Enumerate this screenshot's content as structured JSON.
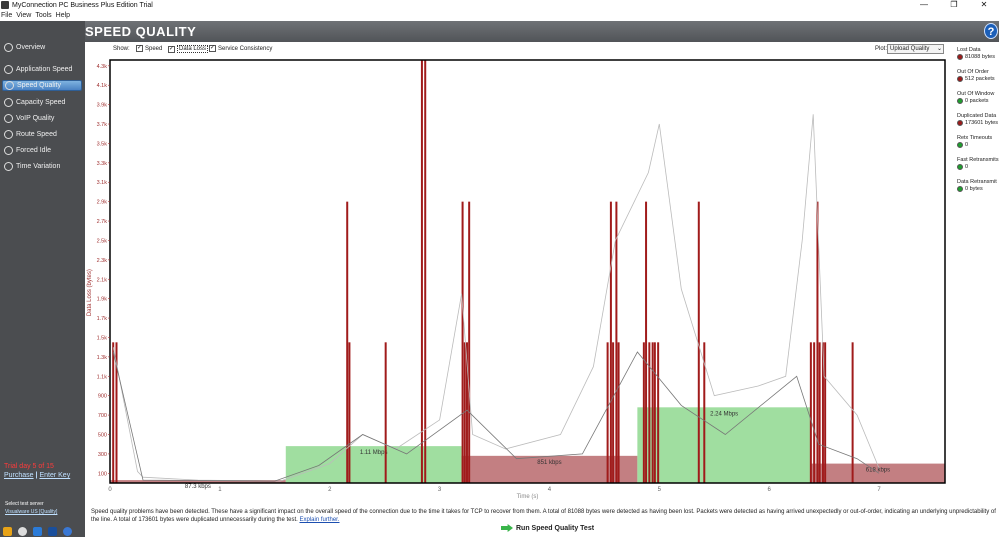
{
  "window": {
    "title": "MyConnection PC Business Plus Edition Trial",
    "controls": [
      "—",
      "❐",
      "✕"
    ]
  },
  "menu": [
    "File",
    "View",
    "Tools",
    "Help"
  ],
  "sidebar": {
    "items": [
      {
        "label": "Overview",
        "icon": "gear-icon"
      },
      {
        "label": "Application Speed",
        "icon": "app-icon"
      },
      {
        "label": "Speed Quality",
        "icon": "speed-icon"
      },
      {
        "label": "Capacity Speed",
        "icon": "capacity-icon"
      },
      {
        "label": "VoIP Quality",
        "icon": "phone-icon"
      },
      {
        "label": "Route Speed",
        "icon": "route-icon"
      },
      {
        "label": "Forced Idle",
        "icon": "idle-icon"
      },
      {
        "label": "Time Variation",
        "icon": "clock-icon"
      }
    ],
    "active_index": 2,
    "trial": "Trial day 5 of 15",
    "purchase": "Purchase",
    "separator": "|",
    "enter_key": "Enter Key",
    "select_server_label": "Select test server",
    "server": "Visualware US [Quality]"
  },
  "header": {
    "title": "SPEED QUALITY",
    "help": "?"
  },
  "controls": {
    "show_label": "Show:",
    "checkboxes": [
      {
        "label": "Speed",
        "checked": true
      },
      {
        "label": "Data Loss",
        "checked": true
      },
      {
        "label": "Service Consistency",
        "checked": true
      }
    ],
    "plot_label": "Plot:",
    "plot_value": "Upload Quality"
  },
  "stats": [
    {
      "label": "Lost Data",
      "value": "81088 bytes",
      "status": "#9b1b1b"
    },
    {
      "label": "Out Of Order",
      "value": "512 packets",
      "status": "#9b1b1b"
    },
    {
      "label": "Out Of Window",
      "value": "0 packets",
      "status": "#1e9e2e"
    },
    {
      "label": "Duplicated Data",
      "value": "173601 bytes",
      "status": "#9b1b1b"
    },
    {
      "label": "Retx Timeouts",
      "value": "0",
      "status": "#1e9e2e"
    },
    {
      "label": "Fast Retransmits",
      "value": "0",
      "status": "#1e9e2e"
    },
    {
      "label": "Data Retransmit",
      "value": "0 bytes",
      "status": "#1e9e2e"
    }
  ],
  "chart_data": {
    "type": "bar",
    "ylabel": "Data Loss (bytes)",
    "xlabel": "Time (s)",
    "yticks": [
      "100",
      "300",
      "500",
      "700",
      "900",
      "1.1k",
      "1.3k",
      "1.5k",
      "1.7k",
      "1.9k",
      "2.1k",
      "2.3k",
      "2.5k",
      "2.7k",
      "2.9k",
      "3.1k",
      "3.3k",
      "3.5k",
      "3.7k",
      "3.9k",
      "4.1k",
      "4.3k"
    ],
    "ytick_values": [
      100,
      300,
      500,
      700,
      900,
      1100,
      1300,
      1500,
      1700,
      1900,
      2100,
      2300,
      2500,
      2700,
      2900,
      3100,
      3300,
      3500,
      3700,
      3900,
      4100,
      4300
    ],
    "xticks": [
      "0",
      "1",
      "2",
      "3",
      "4",
      "5",
      "6",
      "7"
    ],
    "xtick_values": [
      0,
      1,
      2,
      3,
      4,
      5,
      6,
      7
    ],
    "xlim": [
      0,
      7.6
    ],
    "ylim": [
      0,
      4360
    ],
    "speed_segments": [
      {
        "x0": 0.0,
        "x1": 1.6,
        "value": 30,
        "label": "87.3 kbps",
        "color": "#b8686c"
      },
      {
        "x0": 1.6,
        "x1": 3.2,
        "value": 380,
        "label": "1.11 Mbps",
        "color": "#8fd88f"
      },
      {
        "x0": 3.2,
        "x1": 4.8,
        "value": 280,
        "label": "851 kbps",
        "color": "#b8686c"
      },
      {
        "x0": 4.8,
        "x1": 6.38,
        "value": 780,
        "label": "2.24 Mbps",
        "color": "#8fd88f"
      },
      {
        "x0": 6.38,
        "x1": 7.6,
        "value": 200,
        "label": "618 kbps",
        "color": "#b8686c"
      }
    ],
    "loss_bars": [
      [
        0.02,
        1450
      ],
      [
        0.05,
        1450
      ],
      [
        2.15,
        2900
      ],
      [
        2.17,
        1450
      ],
      [
        2.5,
        1450
      ],
      [
        2.83,
        4360
      ],
      [
        2.86,
        4360
      ],
      [
        3.2,
        2900
      ],
      [
        3.22,
        1450
      ],
      [
        3.24,
        1450
      ],
      [
        3.26,
        2900
      ],
      [
        4.52,
        1450
      ],
      [
        4.55,
        2900
      ],
      [
        4.57,
        1450
      ],
      [
        4.6,
        2900
      ],
      [
        4.62,
        1450
      ],
      [
        4.85,
        1450
      ],
      [
        4.87,
        2900
      ],
      [
        4.9,
        1450
      ],
      [
        4.93,
        1450
      ],
      [
        4.95,
        1450
      ],
      [
        4.98,
        1450
      ],
      [
        5.35,
        2900
      ],
      [
        5.4,
        1450
      ],
      [
        6.37,
        1450
      ],
      [
        6.4,
        1450
      ],
      [
        6.43,
        2900
      ],
      [
        6.45,
        1450
      ],
      [
        6.48,
        1450
      ],
      [
        6.5,
        1450
      ],
      [
        6.75,
        1450
      ]
    ],
    "consistency_line_gray": [
      [
        0.03,
        1400
      ],
      [
        0.25,
        120
      ],
      [
        0.3,
        60
      ],
      [
        0.8,
        30
      ],
      [
        1.55,
        20
      ],
      [
        2.0,
        200
      ],
      [
        2.3,
        500
      ],
      [
        2.6,
        350
      ],
      [
        3.0,
        650
      ],
      [
        3.2,
        1950
      ],
      [
        3.3,
        500
      ],
      [
        3.6,
        350
      ],
      [
        4.1,
        500
      ],
      [
        4.4,
        1200
      ],
      [
        4.6,
        2500
      ],
      [
        4.9,
        3200
      ],
      [
        5.0,
        3700
      ],
      [
        5.2,
        2000
      ],
      [
        5.5,
        900
      ],
      [
        5.9,
        1000
      ],
      [
        6.15,
        1100
      ],
      [
        6.3,
        2500
      ],
      [
        6.4,
        3800
      ],
      [
        6.5,
        1100
      ],
      [
        6.8,
        700
      ],
      [
        7.0,
        150
      ]
    ],
    "consistency_line_dark": [
      [
        0.03,
        1350
      ],
      [
        0.3,
        30
      ],
      [
        1.5,
        20
      ],
      [
        1.9,
        180
      ],
      [
        2.3,
        500
      ],
      [
        2.7,
        300
      ],
      [
        3.25,
        750
      ],
      [
        3.7,
        250
      ],
      [
        4.3,
        300
      ],
      [
        4.8,
        1350
      ],
      [
        5.2,
        800
      ],
      [
        5.6,
        500
      ],
      [
        6.25,
        1100
      ],
      [
        6.45,
        400
      ],
      [
        6.8,
        250
      ],
      [
        7.0,
        100
      ]
    ],
    "grid": false
  },
  "footer": {
    "message": "Speed quality problems have been detected. These have a significant impact on the overall speed of the connection due to the time it takes for TCP to recover from them. A total of 81088 bytes were detected as having been lost. Packets were detected as having arrived unexpectedly or out-of-order, indicating an underlying unpredictability of the line. A total of 173601 bytes were duplicated unnecessarily during the test.",
    "link": "Explain further.",
    "run_button": "Run Speed Quality Test"
  }
}
